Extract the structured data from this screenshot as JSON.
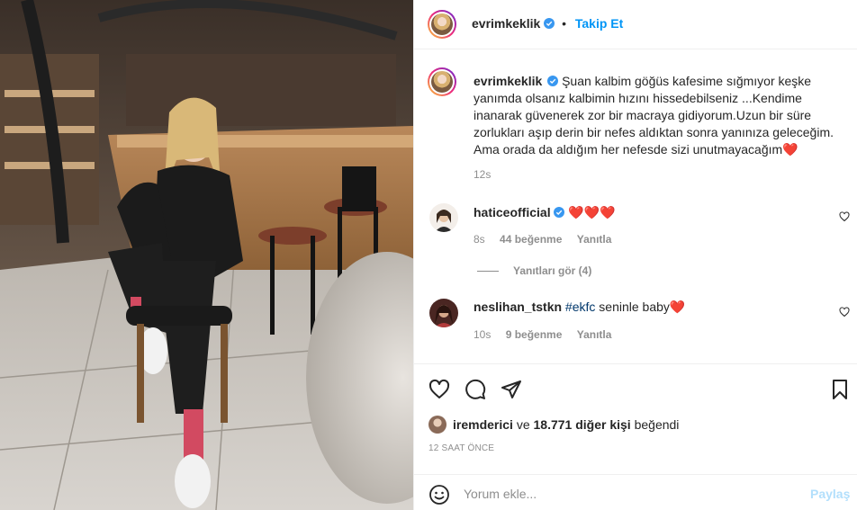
{
  "post": {
    "username": "evrimkeklik",
    "follow_label": "Takip Et",
    "dot": "•",
    "caption_username": "evrimkeklik",
    "caption_text": "Şuan kalbim göğüs kafesime sığmıyor keşke yanımda olsanız kalbimin hızını hissedebilseniz ...Kendime inanarak güvenerek zor bir macraya gidiyorum.Uzun bir süre zorlukları aşıp derin bir nefes aldıktan sonra yanınıza geleceğim. Ama orada da aldığım her nefesde sizi unutmayacağım",
    "caption_heart": "❤️",
    "caption_time": "12s"
  },
  "comments": [
    {
      "username": "haticeofficial",
      "text": "❤️❤️❤️",
      "time": "8s",
      "likes": "44 beğenme",
      "reply": "Yanıtla"
    },
    {
      "username": "neslihan_tstkn",
      "hashtag": "#ekfc",
      "text": " seninle baby",
      "heart": "❤️",
      "time": "10s",
      "likes": "9 beğenme",
      "reply": "Yanıtla"
    }
  ],
  "view_replies": "Yanıtları gör (4)",
  "likes": {
    "user": "iremderici",
    "connector": " ve ",
    "others": "18.771 diğer kişi",
    "suffix": " beğendi"
  },
  "time_ago": "12 SAAT ÖNCE",
  "comment_box": {
    "placeholder": "Yorum ekle...",
    "post_label": "Paylaş"
  },
  "colors": {
    "accent": "#0095f6",
    "heart": "#ed4956",
    "link": "#00376b",
    "muted": "#8e8e8e"
  }
}
